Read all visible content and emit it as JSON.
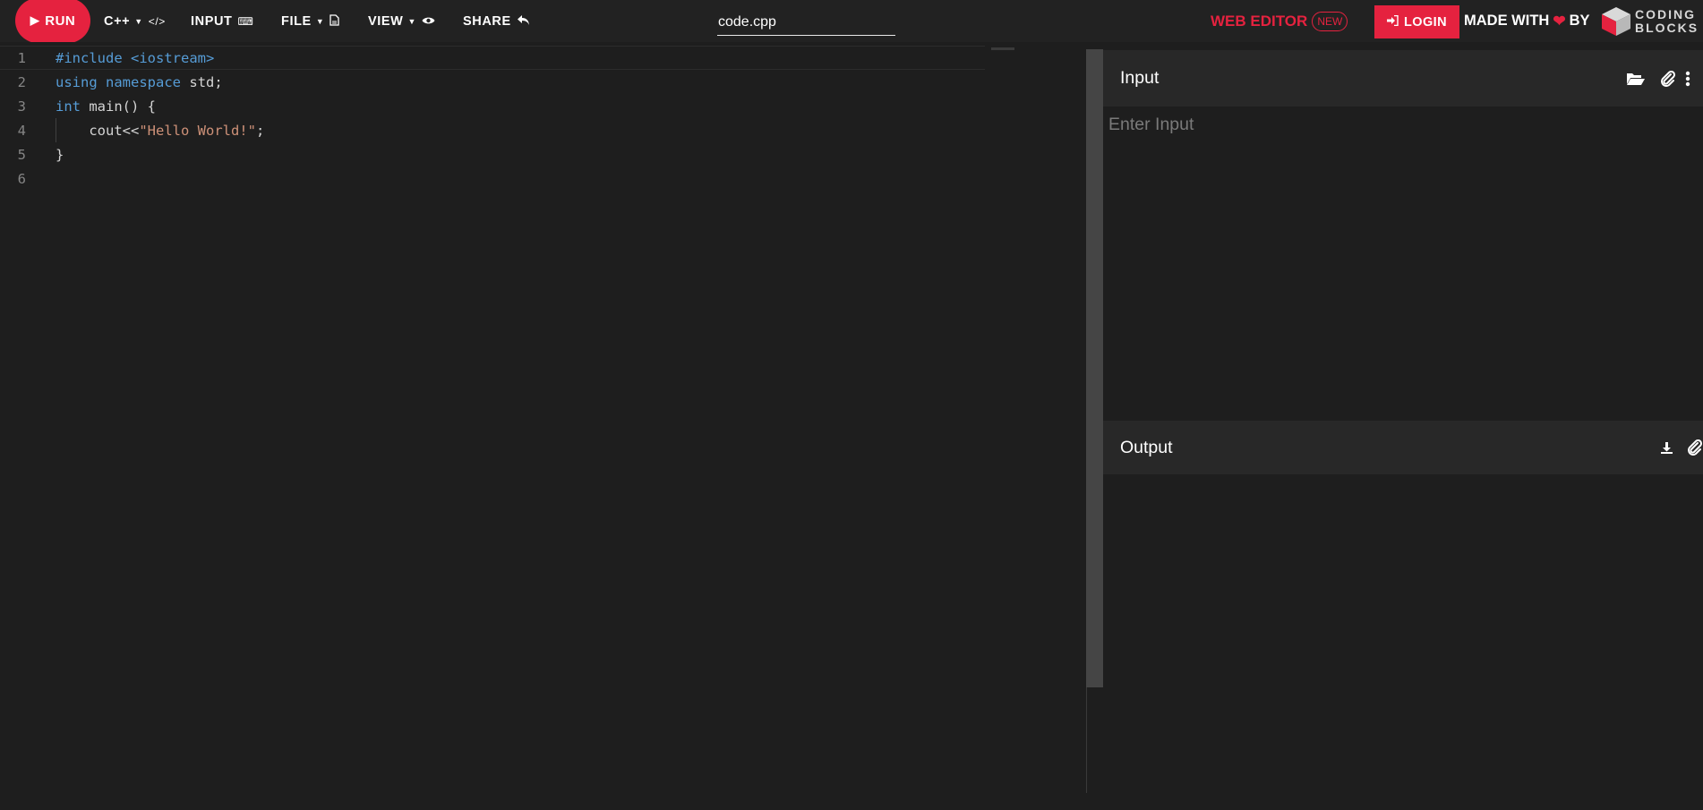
{
  "toolbar": {
    "run_label": "RUN",
    "language_label": "C++",
    "input_label": "INPUT",
    "file_label": "FILE",
    "view_label": "VIEW",
    "share_label": "SHARE",
    "filename_value": "code.cpp",
    "web_editor_label": "WEB EDITOR",
    "new_badge": "NEW",
    "login_label": "LOGIN",
    "made_with_prefix": "MADE WITH",
    "made_with_suffix": "BY",
    "brand_line1": "CODING",
    "brand_line2": "BLOCKS"
  },
  "editor": {
    "line_numbers": [
      "1",
      "2",
      "3",
      "4",
      "5",
      "6"
    ],
    "lines": {
      "l1_directive": "#include",
      "l1_header": "<iostream>",
      "l2_kw1": "using",
      "l2_kw2": "namespace",
      "l2_rest": "std;",
      "l3_kw": "int",
      "l3_rest": "main() {",
      "l4_pre": "    cout<<",
      "l4_str": "\"Hello World!\"",
      "l4_post": ";",
      "l5": "}"
    }
  },
  "input_panel": {
    "title": "Input",
    "placeholder": "Enter Input"
  },
  "output_panel": {
    "title": "Output"
  },
  "icons": {
    "run": "play-icon",
    "language": "code-icon",
    "input": "keyboard-icon",
    "file": "file-icon",
    "view": "eye-icon",
    "share": "share-icon",
    "login": "sign-in-icon",
    "heart": "heart-icon",
    "input_open": "folder-open-icon",
    "input_attach": "paperclip-icon",
    "input_more": "more-vertical-icon",
    "output_download": "download-icon",
    "output_attach": "paperclip-icon"
  },
  "colors": {
    "accent": "#e5223f",
    "background": "#1e1e1e",
    "topbar": "#222222",
    "keyword": "#569cd6",
    "string": "#ce9178"
  }
}
